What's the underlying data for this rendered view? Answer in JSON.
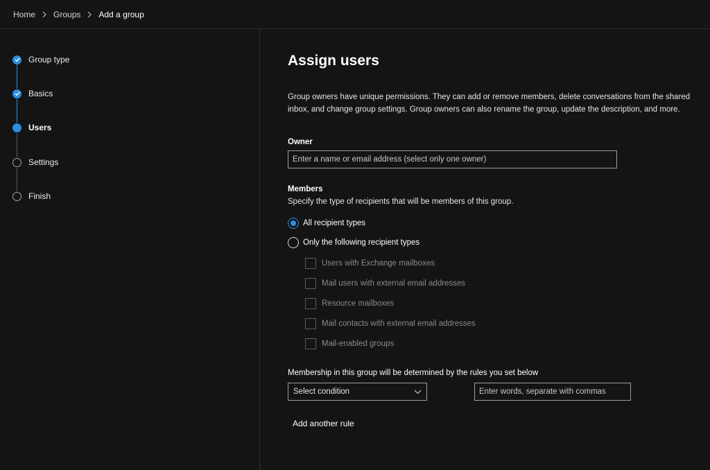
{
  "breadcrumb": {
    "items": [
      "Home",
      "Groups",
      "Add a group"
    ]
  },
  "steps": [
    {
      "label": "Group type",
      "state": "done"
    },
    {
      "label": "Basics",
      "state": "done"
    },
    {
      "label": "Users",
      "state": "current"
    },
    {
      "label": "Settings",
      "state": "pending"
    },
    {
      "label": "Finish",
      "state": "pending"
    }
  ],
  "main": {
    "title": "Assign users",
    "description": "Group owners have unique permissions. They can add or remove members, delete conversations from the shared inbox, and change group settings. Group owners can also rename the group, update the description, and more.",
    "owner": {
      "label": "Owner",
      "placeholder": "Enter a name or email address (select only one owner)",
      "value": ""
    },
    "members": {
      "label": "Members",
      "description": "Specify the type of recipients that will be members of this group.",
      "radio_all": "All recipient types",
      "radio_only": "Only the following recipient types",
      "selected": "all",
      "recipient_types": [
        "Users with Exchange mailboxes",
        "Mail users with external email addresses",
        "Resource mailboxes",
        "Mail contacts with external email addresses",
        "Mail-enabled groups"
      ]
    },
    "rules": {
      "label": "Membership in this group will be determined by the rules you set below",
      "condition_placeholder": "Select condition",
      "words_placeholder": "Enter words, separate with commas",
      "add_rule_label": "Add another rule"
    }
  },
  "colors": {
    "accent": "#2a8fe0",
    "background": "#141414",
    "divider": "#2e2e2e"
  }
}
